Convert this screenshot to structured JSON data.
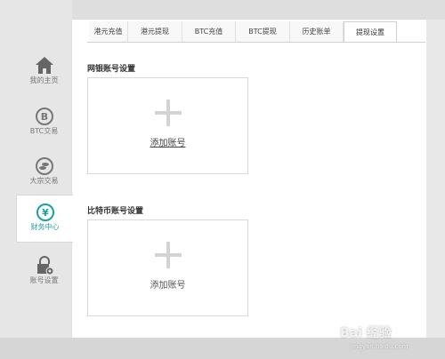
{
  "sidebar": {
    "items": [
      {
        "label": "我的主页",
        "icon": "home-icon"
      },
      {
        "label": "BTC交易",
        "icon": "bitcoin-icon"
      },
      {
        "label": "大宗交易",
        "icon": "coins-icon"
      },
      {
        "label": "财务中心",
        "icon": "yen-icon"
      },
      {
        "label": "账号设置",
        "icon": "lock-settings-icon"
      }
    ],
    "active_index": 3,
    "accent": "#18a0a8"
  },
  "tabs": [
    {
      "label": "港元充值"
    },
    {
      "label": "港元提现"
    },
    {
      "label": "BTC充值"
    },
    {
      "label": "BTC提现"
    },
    {
      "label": "历史账单"
    },
    {
      "label": "提现设置"
    }
  ],
  "active_tab_index": 5,
  "sections": {
    "bank": {
      "title": "网银账号设置",
      "add_label": "添加账号"
    },
    "bitcoin": {
      "title": "比特币账号设置",
      "add_label": "添加账号"
    }
  },
  "watermark": {
    "text": "Bai 经验",
    "subtext": "jingyan.baidu.com"
  }
}
